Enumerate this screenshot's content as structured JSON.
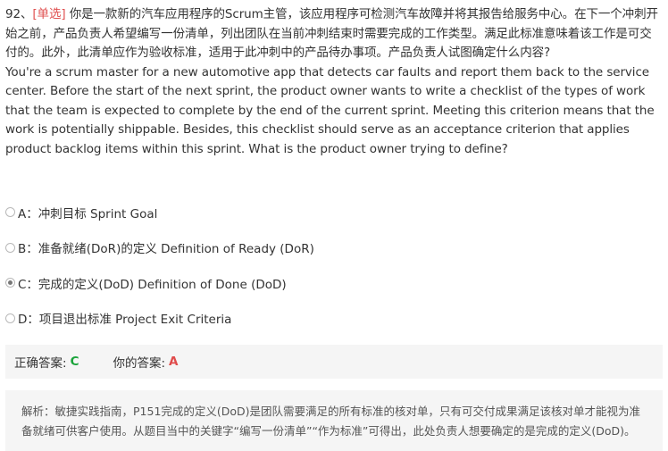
{
  "question": {
    "number": "92、",
    "tag": "[单选]",
    "text_cn": "你是一款新的汽车应用程序的Scrum主管，该应用程序可检测汽车故障并将其报告给服务中心。在下一个冲刺开始之前，产品负责人希望编写一份清单，列出团队在当前冲刺结束时需要完成的工作类型。满足此标准意味着该工作是可交付的。此外，此清单应作为验收标准，适用于此冲刺中的产品待办事项。产品负责人试图确定什么内容?",
    "text_en": "You're a scrum master for a new automotive app that detects car faults and report them back to the service center. Before the start of the next sprint, the product owner wants to write a checklist of the types of work that the team is expected to complete by the end of the current sprint. Meeting this criterion means that the work is potentially shippable. Besides, this checklist should serve as an acceptance criterion that applies product backlog items within this sprint. What is the product owner trying to define?"
  },
  "options": [
    {
      "label": "A：冲刺目标 Sprint Goal",
      "checked": false
    },
    {
      "label": "B：准备就绪(DoR)的定义 Definition of Ready (DoR)",
      "checked": false
    },
    {
      "label": "C：完成的定义(DoD) Definition of Done (DoD)",
      "checked": true
    },
    {
      "label": "D：项目退出标准 Project Exit Criteria",
      "checked": false
    }
  ],
  "answers": {
    "correct_label": "正确答案:",
    "correct_value": "C",
    "yours_label": "你的答案:",
    "yours_value": "A",
    "correct_color": "#1aa33a",
    "wrong_color": "#e04b4b"
  },
  "analysis": {
    "text": "解析：敏捷实践指南，P151完成的定义(DoD)是团队需要满足的所有标准的核对单，只有可交付成果满足该核对单才能视为准备就绪可供客户使用。从题目当中的关键字“编写一份清单”“作为标准”可得出，此处负责人想要确定的是完成的定义(DoD)。"
  }
}
